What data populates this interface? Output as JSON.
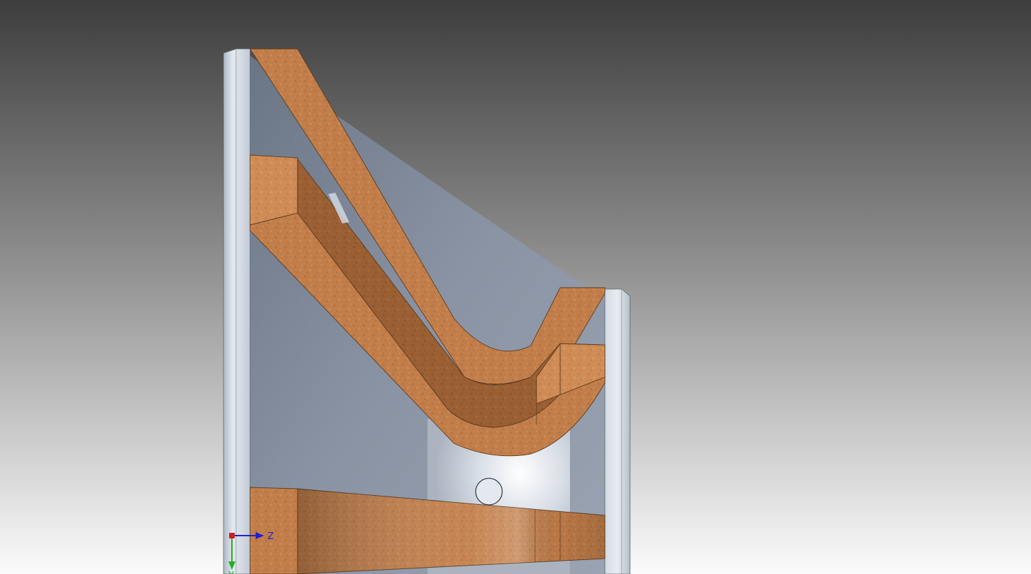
{
  "scene": {
    "background_top": "#3e3e3e",
    "background_bottom": "#ffffff",
    "sheet_metal_color": "#c4ccd6",
    "sheet_metal_dark": "#7c8594",
    "wood_color": "#b07444",
    "wood_light": "#c8864f",
    "wood_dark": "#8b5a30"
  },
  "triad": {
    "z_label": "Z",
    "y_label": "Y",
    "x_color": "#cc2020",
    "y_color": "#20b020",
    "z_color": "#2020cc"
  }
}
